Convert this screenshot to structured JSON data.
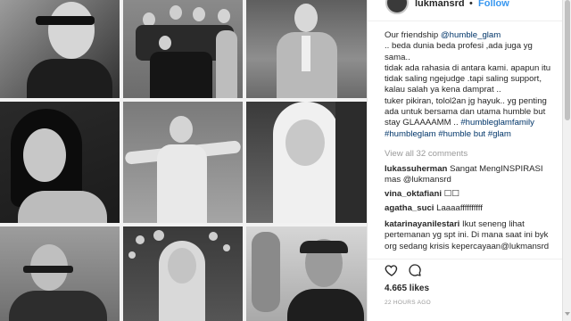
{
  "header": {
    "username": "lukmansrd",
    "separator": "•",
    "follow_label": "Follow"
  },
  "caption": {
    "lines": [
      {
        "text": "Our friendship ",
        "tag": "@humble_glam"
      },
      {
        "text": ".. beda dunia beda profesi ,ada juga yg",
        "tag": ""
      },
      {
        "text": "sama..",
        "tag": ""
      },
      {
        "text": "tidak ada rahasia di antara kami. apapun itu",
        "tag": ""
      },
      {
        "text": "tidak saling ngejudge .tapi saling support,",
        "tag": ""
      },
      {
        "text": "kalau salah ya kena damprat ..",
        "tag": ""
      },
      {
        "text": "tuker pikiran, tolol2an jg hayuk.. yg penting",
        "tag": ""
      },
      {
        "text": "ada untuk bersama dan utama humble but",
        "tag": ""
      },
      {
        "text": "stay GLAAAAMM .. ",
        "tag": "#humbleglamfamily"
      },
      {
        "text": "",
        "tag": "#humbleglam #humble but #glam"
      }
    ]
  },
  "view_all_label": "View all 32 comments",
  "comments": [
    {
      "user": "lukassuherman",
      "lines": [
        "Sangat MengINSPIRASI",
        "mas @lukmansrd"
      ]
    },
    {
      "user": "vina_oktafiani",
      "lines": [
        "☐☐"
      ]
    },
    {
      "user": "agatha_suci",
      "lines": [
        "Laaaaffffffffff"
      ]
    },
    {
      "user": "katarinayanilestari",
      "lines": [
        "Ikut seneng lihat",
        "pertemanan yg spt ini. Di mana saat ini byk",
        "org sedang krisis kepercayaan@lukmansrd"
      ]
    }
  ],
  "likes": "4.665 likes",
  "timestamp": "22 HOURS AGO",
  "icons": [
    "heart-icon",
    "comment-icon"
  ],
  "colors": {
    "follow": "#3897f0",
    "tag": "#003569",
    "text": "#262626",
    "muted": "#999999"
  }
}
